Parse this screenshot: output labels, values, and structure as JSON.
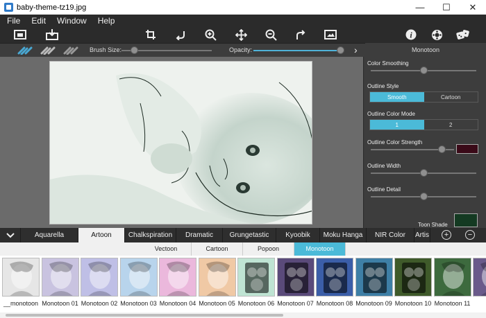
{
  "window": {
    "title": "baby-theme-tz19.jpg",
    "minimize": "—",
    "maximize": "☐",
    "close": "✕"
  },
  "menu": [
    "File",
    "Edit",
    "Window",
    "Help"
  ],
  "toolbar": {
    "icons": [
      "open-image-icon",
      "save-icon",
      "crop-icon",
      "undo-icon",
      "zoom-in-icon",
      "move-icon",
      "zoom-out-icon",
      "redo-icon",
      "fit-image-icon",
      "info-icon",
      "settings-icon",
      "random-icon"
    ]
  },
  "brushbar": {
    "brush_size_label": "Brush Size:",
    "brush_size_value": 0.05,
    "opacity_label": "Opacity:",
    "opacity_value": 1.0,
    "arrow": "›"
  },
  "panel": {
    "title": "Monotoon",
    "color_smoothing_label": "Color Smoothing",
    "color_smoothing_value": 0.5,
    "outline_style_label": "Outline Style",
    "outline_style_options": [
      "Smooth",
      "Cartoon"
    ],
    "outline_style_selected": "Smooth",
    "outline_color_mode_label": "Outline Color Mode",
    "outline_color_mode_options": [
      "1",
      "2"
    ],
    "outline_color_mode_selected": "1",
    "outline_color_strength_label": "Outline Color Strength",
    "outline_color_strength_value": 0.85,
    "outline_color": "#3a0a18",
    "outline_width_label": "Outline Width",
    "outline_width_value": 0.5,
    "outline_detail_label": "Outline Detail",
    "outline_detail_value": 0.5,
    "toon_shade_label": "Toon Shade",
    "toon_shade_color": "#143a22"
  },
  "effect_tabs": [
    "Aquarella",
    "Artoon",
    "Chalkspiration",
    "Dramatic",
    "Grungetastic",
    "Kyoobik",
    "Moku Hanga",
    "NIR Color",
    "Artis"
  ],
  "effect_tab_selected": "Artoon",
  "sub_tabs": [
    "Vectoon",
    "Cartoon",
    "Popoon",
    "Monotoon"
  ],
  "sub_tab_selected": "Monotoon",
  "presets": [
    "__monotoon",
    "Monotoon 01",
    "Monotoon 02",
    "Monotoon 03",
    "Monotoon 04",
    "Monotoon 05",
    "Monotoon 06",
    "Monotoon 07",
    "Monotoon 08",
    "Monotoon 09",
    "Monotoon 10",
    "Monotoon 11",
    "Mo"
  ],
  "accent": "#4bbad8"
}
